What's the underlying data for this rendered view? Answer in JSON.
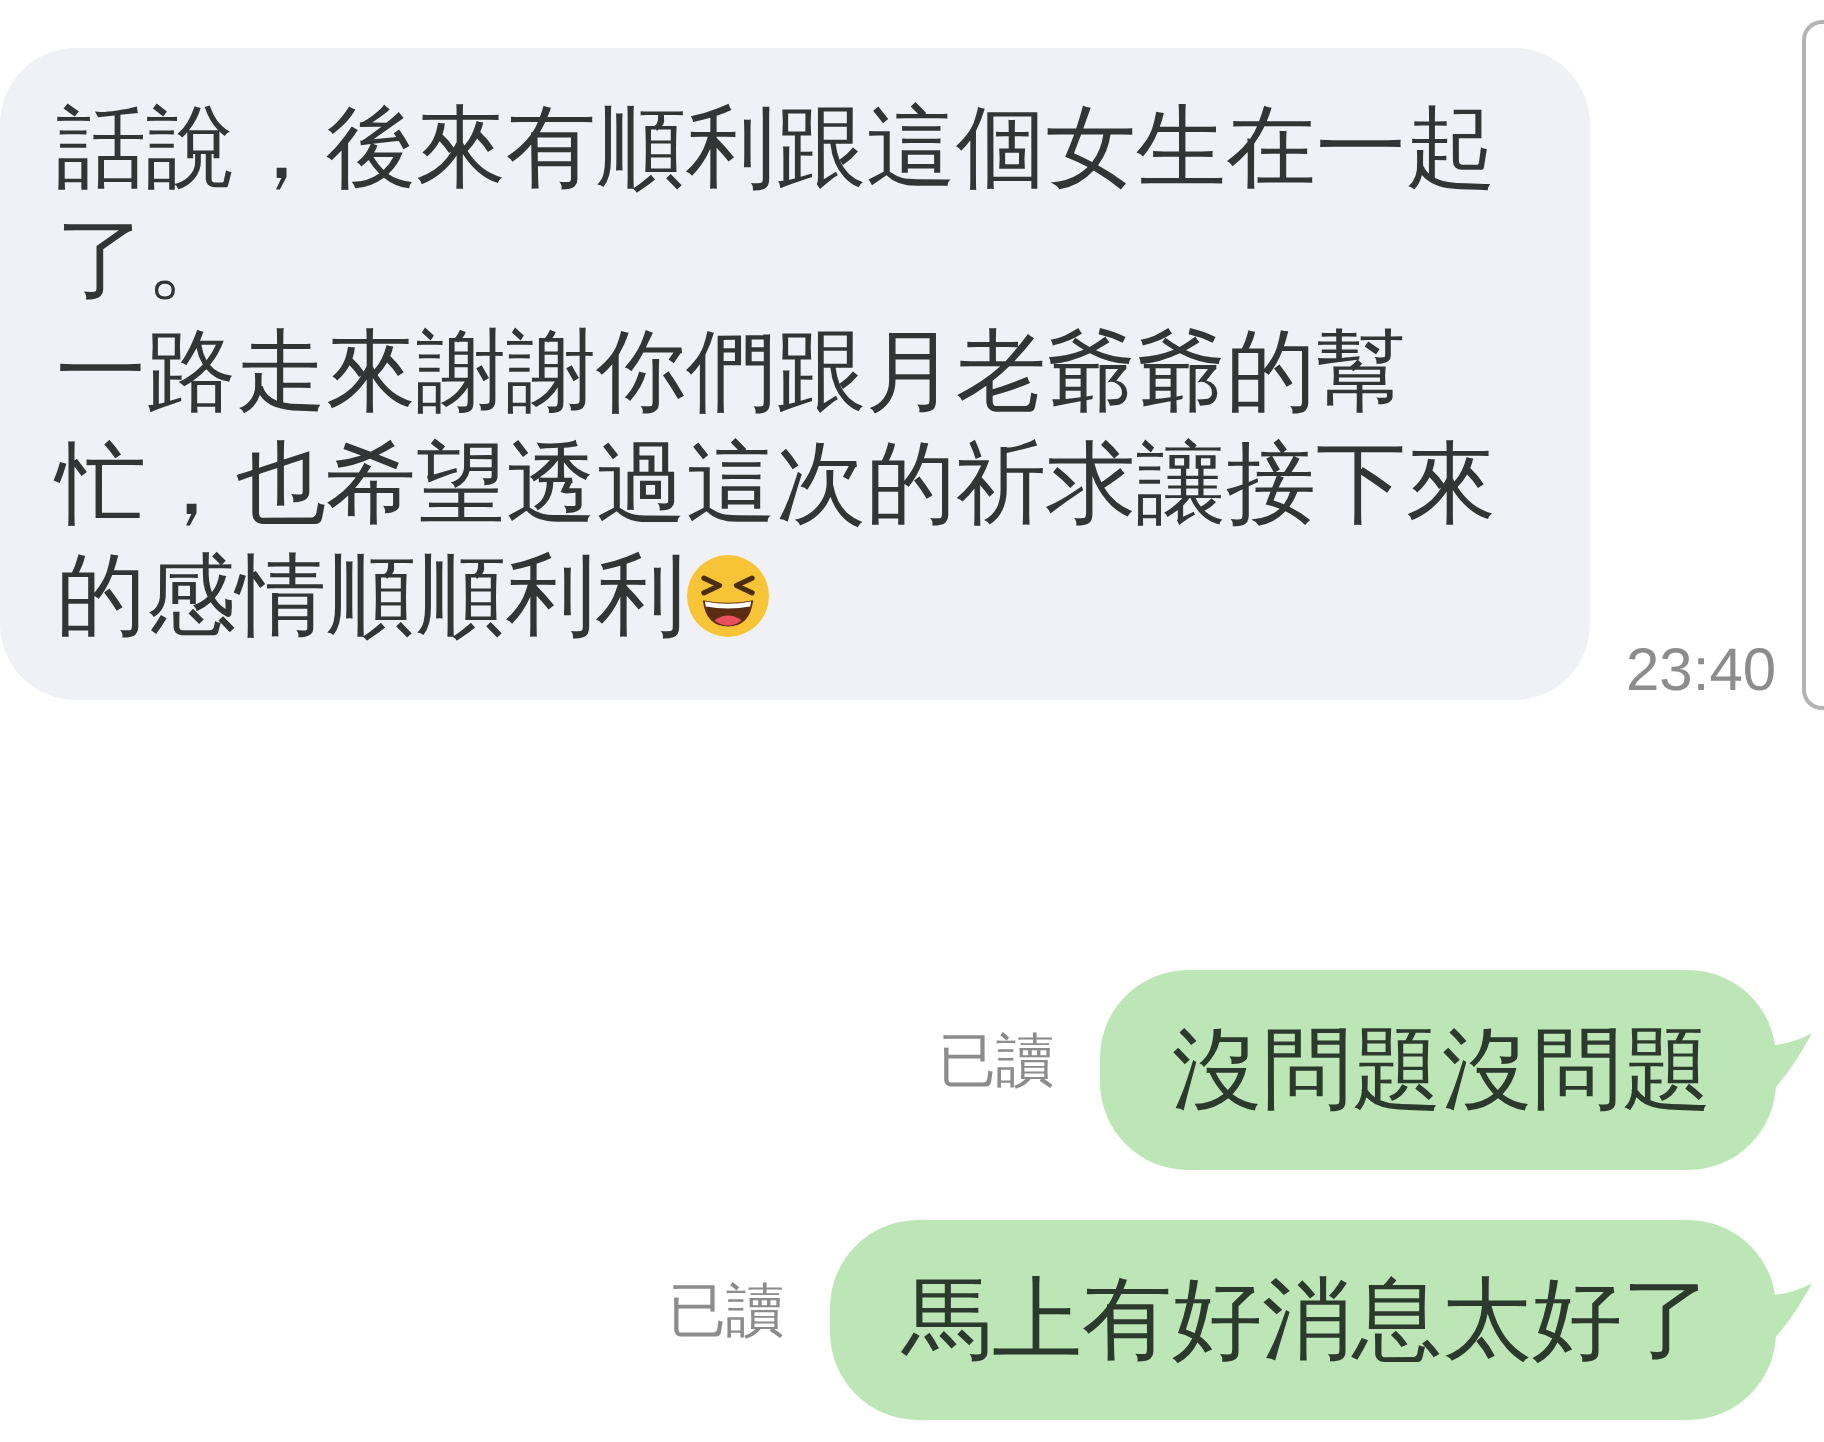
{
  "messages": [
    {
      "kind": "received",
      "parts": [
        {
          "kind": "text",
          "text": "話說，後來有順利跟這個女生在一起了。"
        },
        {
          "kind": "text",
          "text": "一路走來謝謝你們跟月老爺爺的幫忙，也希望透過這次的祈求讓接下來的感情順順利利"
        },
        {
          "kind": "emoji"
        }
      ],
      "time": "23:40"
    },
    {
      "kind": "sent",
      "read_label": "已讀",
      "text": "沒問題沒問題"
    },
    {
      "kind": "sent",
      "read_label": "已讀",
      "text": "馬上有好消息太好了"
    }
  ]
}
